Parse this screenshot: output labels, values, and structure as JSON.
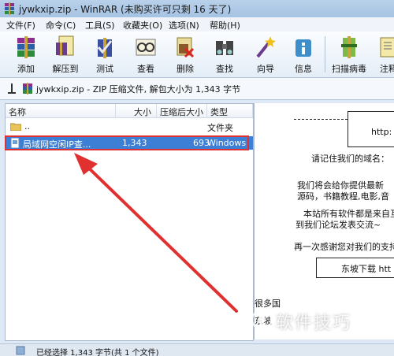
{
  "window": {
    "title": "jywkxip.zip - WinRAR (未购买许可只剩 16 天了)"
  },
  "menu": [
    "文件(F)",
    "命令(C)",
    "工具(S)",
    "收藏夹(O)",
    "选项(N)",
    "帮助(H)"
  ],
  "toolbar": [
    {
      "label": "添加",
      "icon": "add-archive-icon"
    },
    {
      "label": "解压到",
      "icon": "extract-to-icon"
    },
    {
      "label": "测试",
      "icon": "test-icon"
    },
    {
      "label": "查看",
      "icon": "view-icon"
    },
    {
      "label": "删除",
      "icon": "delete-icon"
    },
    {
      "label": "查找",
      "icon": "find-icon"
    },
    {
      "label": "向导",
      "icon": "wizard-icon"
    },
    {
      "label": "信息",
      "icon": "info-icon"
    },
    {
      "label": "扫描病毒",
      "icon": "virus-scan-icon"
    },
    {
      "label": "注释",
      "icon": "comment-icon"
    }
  ],
  "address": {
    "text": "jywkxip.zip - ZIP 压缩文件, 解包大小为 1,343 字节"
  },
  "columns": {
    "name": "名称",
    "size": "大小",
    "packed": "压缩后大小",
    "type": "类型"
  },
  "files": [
    {
      "name": "..",
      "size": "",
      "packed": "",
      "type": "文件夹"
    },
    {
      "name": "局域网空闲IP查...",
      "size": "1,343",
      "packed": "693",
      "type": "Windows"
    }
  ],
  "comment": {
    "header_line": "http:",
    "lines": [
      "请记住我们的域名：",
      "我们将会给你提供最新",
      "源码，书籍教程,电影,音",
      "本站所有软件都是来自互",
      "到我们论坛发表交流~",
      "再一次感谢您对我们的支持",
      "东坡下载  htt",
      "很多国",
      "东坡"
    ]
  },
  "status": {
    "text": "已经选择 1,343 字节(共 1 个文件)"
  },
  "watermark": {
    "text": "软件技巧"
  },
  "colors": {
    "selection": "#3d7fd4",
    "highlight": "#e03030",
    "arrow": "#e03030"
  }
}
